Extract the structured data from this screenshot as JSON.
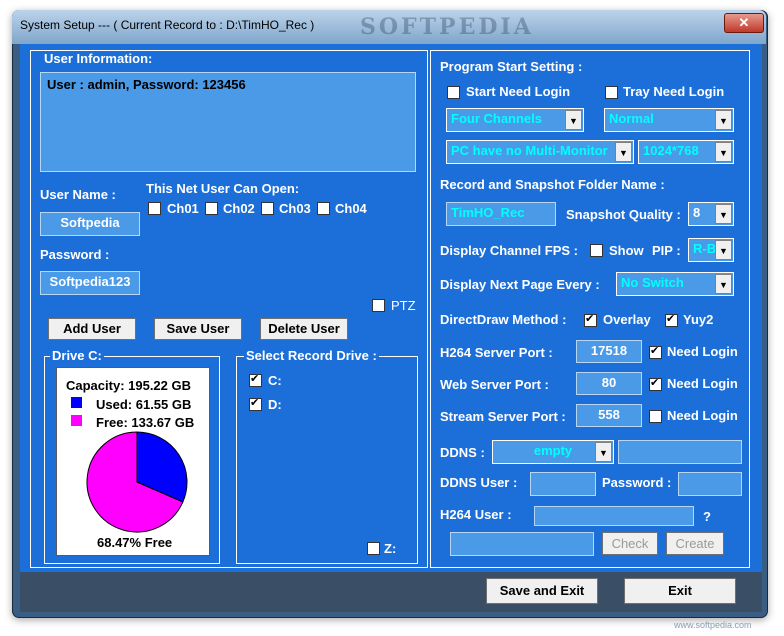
{
  "window": {
    "title": "System Setup --- ( Current Record to : D:\\TimHO_Rec )",
    "watermark": "SOFTPEDIA",
    "close_label": "✕"
  },
  "user_info": {
    "heading": "User Information:",
    "text": "User : admin, Password: 123456",
    "user_name_label": "User Name :",
    "user_name_value": "Softpedia",
    "password_label": "Password :",
    "password_value": "Softpedia123",
    "can_open_label": "This Net User Can Open:",
    "channels": [
      {
        "label": "Ch01",
        "checked": false
      },
      {
        "label": "Ch02",
        "checked": false
      },
      {
        "label": "Ch03",
        "checked": false
      },
      {
        "label": "Ch04",
        "checked": false
      }
    ],
    "ptz_label": "PTZ",
    "add_user": "Add User",
    "save_user": "Save User",
    "delete_user": "Delete User"
  },
  "drive": {
    "legend": "Drive C:",
    "capacity": "Capacity: 195.22 GB",
    "used": "Used: 61.55 GB",
    "free": "Free: 133.67 GB",
    "free_pct_text": "68.47% Free",
    "free_fraction": 0.6847,
    "used_color": "#0000ff",
    "free_color": "#ff00ff"
  },
  "record_drive": {
    "legend": "Select Record Drive :",
    "drives": [
      {
        "label": "C:",
        "checked": true
      },
      {
        "label": "D:",
        "checked": true
      }
    ],
    "z_label": "Z:"
  },
  "program_start": {
    "heading": "Program Start Setting :",
    "start_need_login": "Start Need Login",
    "tray_need_login": "Tray Need Login",
    "channels_combo": "Four Channels",
    "mode_combo": "Normal",
    "monitor_combo": "PC have no Multi-Monitor",
    "resolution_combo": "1024*768",
    "folder_label": "Record and Snapshot Folder Name :",
    "folder_value": "TimHO_Rec",
    "snapshot_quality_label": "Snapshot Quality :",
    "snapshot_quality_value": "8",
    "display_fps_label": "Display Channel FPS :",
    "show_label": "Show",
    "pip_label": "PIP :",
    "pip_value": "R-B",
    "next_page_label": "Display Next Page Every :",
    "next_page_value": "No Switch",
    "directdraw_label": "DirectDraw Method :",
    "overlay_label": "Overlay",
    "yuy2_label": "Yuy2",
    "h264_port_label": "H264 Server Port :",
    "h264_port_value": "17518",
    "web_port_label": "Web Server Port :",
    "web_port_value": "80",
    "stream_port_label": "Stream Server Port :",
    "stream_port_value": "558",
    "need_login": "Need Login",
    "ddns_label": "DDNS :",
    "ddns_value": "empty",
    "ddns_user_label": "DDNS User :",
    "ddns_password_label": "Password :",
    "h264_user_label": "H264 User :",
    "question": "?",
    "check_label": "Check",
    "create_label": "Create"
  },
  "footer": {
    "save_exit": "Save and Exit",
    "exit": "Exit"
  },
  "site_watermark": "www.softpedia.com",
  "colors": {
    "client_bg": "#1c6fd9",
    "field_bg": "#4a9ae8",
    "footer_bg": "#3a4e66"
  }
}
